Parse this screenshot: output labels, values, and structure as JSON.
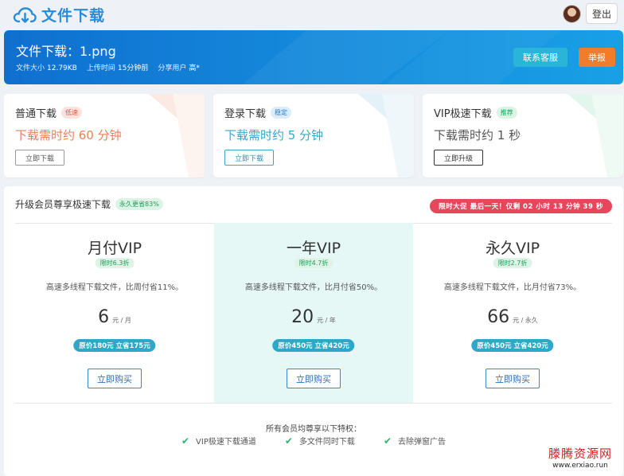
{
  "header": {
    "brand_title": "文件下载",
    "brand_icon": "cloud-download-icon",
    "logout_label": "登出"
  },
  "hero": {
    "title": "文件下载：1.png",
    "size_label": "文件大小",
    "size_value": "12.79KB",
    "uploaded_label": "上传时间",
    "uploaded_value": "15分钟前",
    "sharer_label": "分享用户",
    "sharer_value": "高*",
    "service_label": "联系客服",
    "report_label": "举报",
    "colors": {
      "service": "#2ab5d8",
      "report": "#f07d2e"
    }
  },
  "options": [
    {
      "name": "普通下载",
      "tag": "低速",
      "time": "下载需时约 60 分钟",
      "button": "立即下载",
      "color": "#e8805a"
    },
    {
      "name": "登录下载",
      "tag": "稳定",
      "time": "下载需时约 5 分钟",
      "button": "立即下载",
      "color": "#3aa6c9"
    },
    {
      "name": "VIP极速下载",
      "tag": "推荐",
      "time": "下载需时约 1 秒",
      "button": "立即升级",
      "color": "#555555"
    }
  ],
  "vip": {
    "title": "升级会员尊享极速下载",
    "badge": "永久更省83%",
    "promo": "限时大促 最后一天！仅剩 02 小时 13 分钟 39 秒",
    "plans": [
      {
        "name": "月付VIP",
        "discount": "限时6.3折",
        "desc": "高速多线程下载文件，比周付省11%。",
        "price": "6",
        "unit": "元 / 月",
        "original": "原价180元 立省175元",
        "buy": "立即购买",
        "highlight": false
      },
      {
        "name": "一年VIP",
        "discount": "限时4.7折",
        "desc": "高速多线程下载文件，比月付省50%。",
        "price": "20",
        "unit": "元 / 年",
        "original": "原价450元 立省420元",
        "buy": "立即购买",
        "highlight": true
      },
      {
        "name": "永久VIP",
        "discount": "限时2.7折",
        "desc": "高速多线程下载文件，比月付省73%。",
        "price": "66",
        "unit": "元 / 永久",
        "original": "原价450元 立省420元",
        "buy": "立即购买",
        "highlight": false
      }
    ],
    "perks_title": "所有会员均尊享以下特权：",
    "perks": [
      "VIP极速下载通道",
      "多文件同时下载",
      "去除弹窗广告"
    ]
  },
  "watermark": {
    "name": "滕腾资源网",
    "url": "www.erxiao.run"
  }
}
